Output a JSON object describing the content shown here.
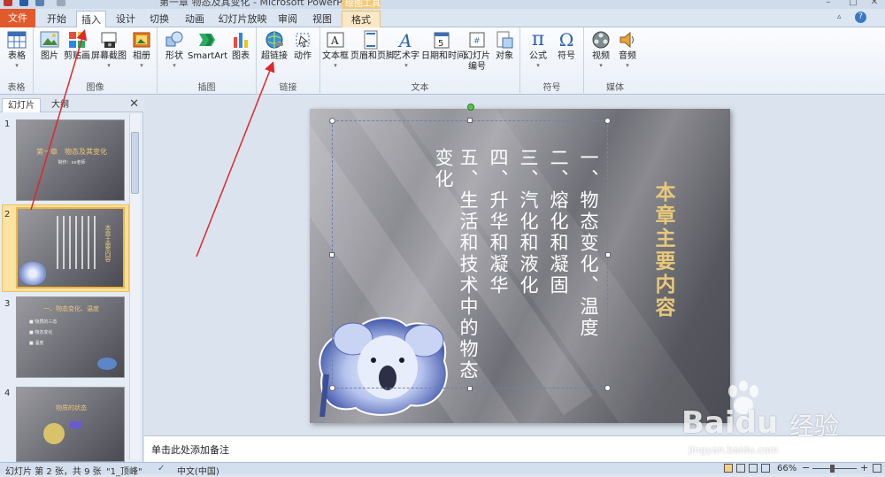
{
  "window": {
    "title": "第一章 物态及其变化 - Microsoft PowerPoint",
    "context_tab_header": "绘图工具"
  },
  "tabs": [
    {
      "label": "文件"
    },
    {
      "label": "开始"
    },
    {
      "label": "插入",
      "active": true
    },
    {
      "label": "设计"
    },
    {
      "label": "切换"
    },
    {
      "label": "动画"
    },
    {
      "label": "幻灯片放映"
    },
    {
      "label": "审阅"
    },
    {
      "label": "视图"
    },
    {
      "label": "格式"
    }
  ],
  "ribbon": {
    "groups": [
      {
        "name": "表格",
        "buttons": [
          {
            "label": "表格",
            "icon": "table-icon"
          }
        ]
      },
      {
        "name": "图像",
        "buttons": [
          {
            "label": "图片",
            "icon": "picture-icon"
          },
          {
            "label": "剪贴画",
            "icon": "clipart-icon"
          },
          {
            "label": "屏幕截图",
            "icon": "screenshot-icon"
          },
          {
            "label": "相册",
            "icon": "album-icon"
          }
        ]
      },
      {
        "name": "插图",
        "buttons": [
          {
            "label": "形状",
            "icon": "shapes-icon"
          },
          {
            "label": "SmartArt",
            "icon": "smartart-icon"
          },
          {
            "label": "图表",
            "icon": "chart-icon"
          }
        ]
      },
      {
        "name": "链接",
        "buttons": [
          {
            "label": "超链接",
            "icon": "hyperlink-icon"
          },
          {
            "label": "动作",
            "icon": "action-icon"
          }
        ]
      },
      {
        "name": "文本",
        "buttons": [
          {
            "label": "文本框",
            "icon": "textbox-icon"
          },
          {
            "label": "页眉和页脚",
            "icon": "header-footer-icon"
          },
          {
            "label": "艺术字",
            "icon": "wordart-icon"
          },
          {
            "label": "日期和时间",
            "icon": "datetime-icon"
          },
          {
            "label": "幻灯片编号",
            "icon": "slide-number-icon"
          },
          {
            "label": "对象",
            "icon": "object-icon"
          }
        ]
      },
      {
        "name": "符号",
        "buttons": [
          {
            "label": "公式",
            "icon": "equation-icon"
          },
          {
            "label": "符号",
            "icon": "symbol-icon"
          }
        ]
      },
      {
        "name": "媒体",
        "buttons": [
          {
            "label": "视频",
            "icon": "video-icon"
          },
          {
            "label": "音频",
            "icon": "audio-icon"
          }
        ]
      }
    ]
  },
  "panel": {
    "tabs": [
      "幻灯片",
      "大纲"
    ],
    "slides": [
      {
        "num": "1",
        "title": "第一章　物态及其变化",
        "sub": "制作：xx老师"
      },
      {
        "num": "2",
        "title": "本章主要内容",
        "selected": true
      },
      {
        "num": "3",
        "title": "一、物态变化、温度",
        "bullets": [
          "■ 物质的三态",
          "■ 物态变化",
          "■ 温度"
        ]
      },
      {
        "num": "4",
        "title": "物质的状态"
      }
    ]
  },
  "slide": {
    "title": "本章主要内容",
    "columns": [
      "一、物态变化、温度",
      "二、熔化和凝固",
      "三、汽化和液化",
      "四、升华和凝华",
      "五、生活和技术中的物态",
      "变化"
    ]
  },
  "notes": {
    "placeholder": "单击此处添加备注"
  },
  "status": {
    "slide_info": "幻灯片 第 2 张，共 9 张",
    "theme": "\"1_顶峰\"",
    "language": "中文(中国)",
    "zoom": "66%"
  },
  "watermark": {
    "brand": "Bai",
    "brand2": "du",
    "cn": "经验",
    "url": "jingyan.baidu.com"
  },
  "colors": {
    "file_tab": "#e2592c",
    "title_gold": "#e8c97a",
    "selection": "#f0b640",
    "arrow": "#e0282a"
  }
}
